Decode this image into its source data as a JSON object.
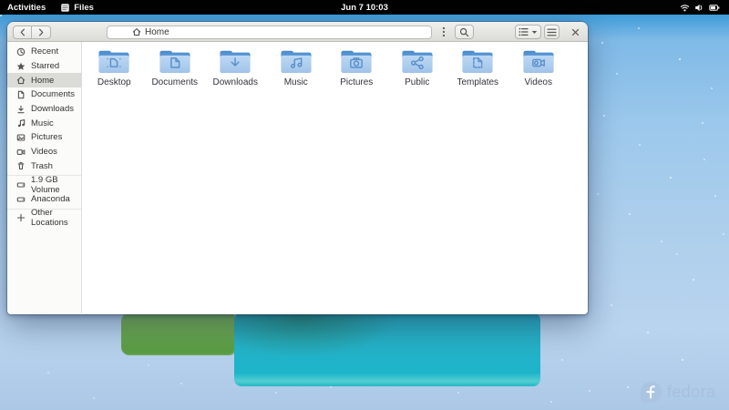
{
  "topbar": {
    "activities_label": "Activities",
    "app_menu_label": "Files",
    "clock": "Jun 7 10:03",
    "tray": [
      "wifi-icon",
      "volume-icon",
      "battery-icon"
    ]
  },
  "window": {
    "pathbar": {
      "location": "Home"
    },
    "sidebar": {
      "items": [
        {
          "label": "Recent",
          "icon": "recent-icon"
        },
        {
          "label": "Starred",
          "icon": "star-icon"
        },
        {
          "label": "Home",
          "icon": "home-icon",
          "selected": true
        },
        {
          "label": "Documents",
          "icon": "document-icon"
        },
        {
          "label": "Downloads",
          "icon": "download-icon"
        },
        {
          "label": "Music",
          "icon": "music-note-icon"
        },
        {
          "label": "Pictures",
          "icon": "image-icon"
        },
        {
          "label": "Videos",
          "icon": "video-camera-icon"
        },
        {
          "label": "Trash",
          "icon": "trash-icon"
        }
      ],
      "devices": [
        {
          "label": "1.9 GB Volume",
          "icon": "drive-icon"
        },
        {
          "label": "Anaconda",
          "icon": "drive-icon"
        }
      ],
      "other_locations": {
        "label": "Other Locations",
        "icon": "plus-icon"
      }
    },
    "folders": [
      {
        "label": "Desktop",
        "emblem": "desktop"
      },
      {
        "label": "Documents",
        "emblem": "document"
      },
      {
        "label": "Downloads",
        "emblem": "download-arrow"
      },
      {
        "label": "Music",
        "emblem": "music-notes"
      },
      {
        "label": "Pictures",
        "emblem": "camera"
      },
      {
        "label": "Public",
        "emblem": "share"
      },
      {
        "label": "Templates",
        "emblem": "template-document"
      },
      {
        "label": "Videos",
        "emblem": "video-camera"
      }
    ]
  },
  "desktop": {
    "brand": "fedora"
  },
  "colors": {
    "topbar_bg": "#020202",
    "wallpaper_top": "#3f9cd9",
    "wallpaper_bottom": "#b9d4ee",
    "accent_blue": "#3584e4",
    "folder_tab": "#4a8ccc",
    "folder_body": "#abcbec",
    "folder_emblem": "#5b8fca",
    "teal_window": "#1db4ca",
    "green_window": "#67a94e",
    "fedora_brand": "#a6c0de",
    "sidebar_selection": "#dbdbd8"
  }
}
